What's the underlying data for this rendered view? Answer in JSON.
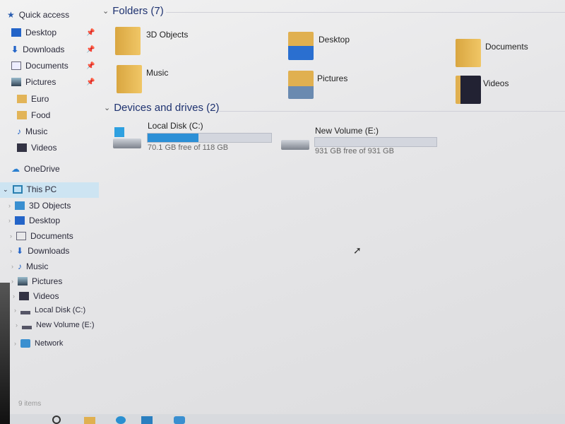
{
  "sidebar": {
    "quick_access": "Quick access",
    "quick_items": [
      {
        "label": "Desktop",
        "pinned": true,
        "icon": "desktop-icon"
      },
      {
        "label": "Downloads",
        "pinned": true,
        "icon": "download-arrow-icon"
      },
      {
        "label": "Documents",
        "pinned": true,
        "icon": "document-icon"
      },
      {
        "label": "Pictures",
        "pinned": true,
        "icon": "picture-icon"
      },
      {
        "label": "Euro",
        "icon": "folder-icon"
      },
      {
        "label": "Food",
        "icon": "folder-icon"
      },
      {
        "label": "Music",
        "icon": "music-note-icon"
      },
      {
        "label": "Videos",
        "icon": "video-icon"
      }
    ],
    "onedrive": "OneDrive",
    "this_pc": "This PC",
    "pc_items": [
      {
        "label": "3D Objects"
      },
      {
        "label": "Desktop"
      },
      {
        "label": "Documents"
      },
      {
        "label": "Downloads"
      },
      {
        "label": "Music"
      },
      {
        "label": "Pictures"
      },
      {
        "label": "Videos"
      },
      {
        "label": "Local Disk (C:)"
      },
      {
        "label": "New Volume (E:)"
      }
    ],
    "network": "Network"
  },
  "main": {
    "folders_header": "Folders (7)",
    "folders": [
      {
        "label": "3D Objects"
      },
      {
        "label": "Desktop"
      },
      {
        "label": "Documents"
      },
      {
        "label": "Music"
      },
      {
        "label": "Pictures"
      },
      {
        "label": "Videos"
      }
    ],
    "drives_header": "Devices and drives (2)",
    "drives": [
      {
        "label": "Local Disk (C:)",
        "free": "70.1 GB free of 118 GB",
        "used_fraction": 0.41
      },
      {
        "label": "New Volume (E:)",
        "free": "931 GB free of 931 GB",
        "used_fraction": 0.0
      }
    ]
  },
  "status": {
    "items": "9 items"
  },
  "colors": {
    "accent": "#2b8fd6",
    "selection": "#cde4f2",
    "header": "#1e3270"
  }
}
